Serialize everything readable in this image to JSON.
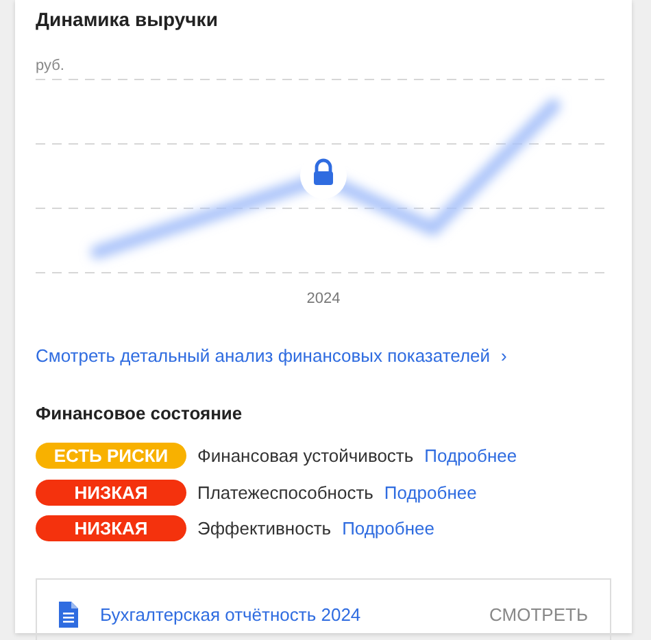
{
  "title": "Динамика выручки",
  "chart": {
    "unit": "руб.",
    "x_label": "2024",
    "locked": true
  },
  "details_link": "Смотреть детальный анализ финансовых показателей",
  "details_arrow": "›",
  "financial_state": {
    "title": "Финансовое состояние",
    "rows": [
      {
        "badge": "ЕСТЬ РИСКИ",
        "color": "#f8b100",
        "label": "Финансовая устойчивость",
        "link": "Подробнее"
      },
      {
        "badge": "НИЗКАЯ",
        "color": "#f4320d",
        "label": "Платежеспособность",
        "link": "Подробнее"
      },
      {
        "badge": "НИЗКАЯ",
        "color": "#f4320d",
        "label": "Эффективность",
        "link": "Подробнее"
      }
    ]
  },
  "report": {
    "title": "Бухгалтерская отчётность 2024",
    "action": "СМОТРЕТЬ"
  }
}
